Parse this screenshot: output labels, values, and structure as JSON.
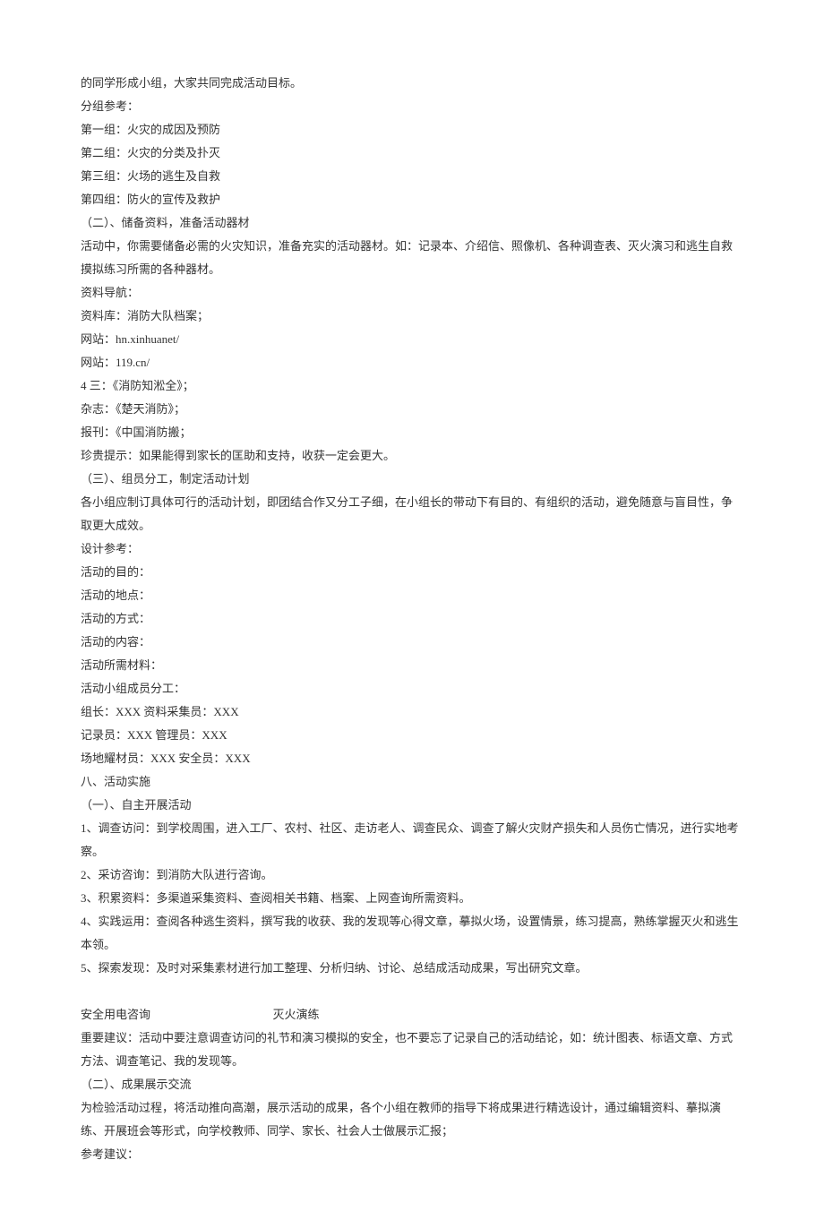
{
  "lines": [
    "的同学形成小组，大家共同完成活动目标。",
    "分组参考：",
    "第一组：火灾的成因及预防",
    "第二组：火灾的分类及扑灭",
    "第三组：火场的逃生及自救",
    "第四组：防火的宣传及救护",
    "（二）、储备资料，准备活动器材",
    "活动中，你需要储备必需的火灾知识，准备充实的活动器材。如：记录本、介绍信、照像机、各种调查表、灭火演习和逃生自救摸拟练习所需的各种器材。",
    "资料导航：",
    "资料库：消防大队档案；",
    "网站：hn.xinhuanet/",
    "网站：119.cn/",
    "4 三：《消防知淞全》；",
    "杂志：《楚天消防》；",
    "报刊：《中国消防搬；",
    "珍贵提示：如果能得到家长的匡助和支持，收获一定会更大。",
    "（三）、组员分工，制定活动计划",
    "各小组应制订具体可行的活动计划，即团结合作又分工子细，在小组长的带动下有目的、有组织的活动，避免随意与盲目性，争取更大成效。",
    "设计参考：",
    "活动的目的：",
    "活动的地点：",
    "活动的方式：",
    "活动的内容：",
    "活动所需材料：",
    "活动小组成员分工：",
    "组长：XXX 资料采集员：XXX",
    "记录员：XXX 管理员：XXX",
    "场地耀材员：XXX 安全员：XXX",
    "八、活动实施",
    "（一）、自主开展活动",
    "1、调查访问：到学校周围，进入工厂、农村、社区、走访老人、调查民众、调查了解火灾财产损失和人员伤亡情况，进行实地考察。",
    "2、采访咨询：到消防大队进行咨询。",
    "3、积累资料：多渠道采集资料、查阅相关书籍、档案、上网查询所需资料。",
    "4、实践运用：查阅各种逃生资料，撰写我的收获、我的发现等心得文章，摹拟火场，设置情景，练习提高，熟练掌握灭火和逃生本领。",
    "5、探索发现：及时对采集素材进行加工整理、分析归纳、讨论、总结成活动成果，写出研究文章。"
  ],
  "caption_row": {
    "left": "安全用电咨询",
    "right": "灭火演练"
  },
  "tail_lines": [
    "重要建议：活动中要注意调查访问的礼节和演习模拟的安全，也不要忘了记录自己的活动结论，如：统计图表、标语文章、方式方法、调查笔记、我的发现等。",
    "（二）、成果展示交流",
    "为检验活动过程，将活动推向高潮，展示活动的成果，各个小组在教师的指导下将成果进行精选设计，通过编辑资料、摹拟演练、开展班会等形式，向学校教师、同学、家长、社会人士做展示汇报；",
    "参考建议："
  ]
}
